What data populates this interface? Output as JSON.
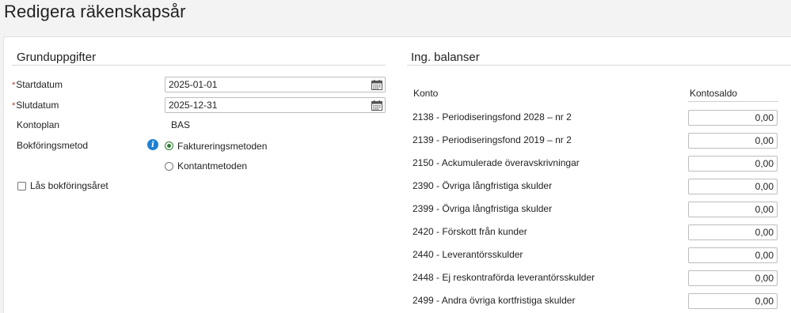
{
  "page": {
    "title": "Redigera räkenskapsår"
  },
  "grunduppgifter": {
    "title": "Grunduppgifter",
    "required_marker": "*",
    "startdatum_label": "Startdatum",
    "startdatum_value": "2025-01-01",
    "slutdatum_label": "Slutdatum",
    "slutdatum_value": "2025-12-31",
    "kontoplan_label": "Kontoplan",
    "kontoplan_value": "BAS",
    "bokforingsmetod_label": "Bokföringsmetod",
    "metod_options": [
      "Faktureringsmetoden",
      "Kontantmetoden"
    ],
    "metod_selected": "Faktureringsmetoden",
    "las_label": "Lås bokföringsåret",
    "las_checked": false
  },
  "balanser": {
    "title": "Ing. balanser",
    "col_konto": "Konto",
    "col_saldo": "Kontosaldo",
    "rows": [
      {
        "konto": "2138 - Periodiseringsfond 2028 – nr 2",
        "saldo": "0,00"
      },
      {
        "konto": "2139 - Periodiseringsfond 2019 – nr 2",
        "saldo": "0,00"
      },
      {
        "konto": "2150 - Ackumulerade överavskrivningar",
        "saldo": "0,00"
      },
      {
        "konto": "2390 - Övriga långfristiga skulder",
        "saldo": "0,00"
      },
      {
        "konto": "2399 - Övriga långfristiga skulder",
        "saldo": "0,00"
      },
      {
        "konto": "2420 - Förskott från kunder",
        "saldo": "0,00"
      },
      {
        "konto": "2440 - Leverantörsskulder",
        "saldo": "0,00"
      },
      {
        "konto": "2448 - Ej reskontraförda leverantörsskulder",
        "saldo": "0,00"
      },
      {
        "konto": "2499 - Andra övriga kortfristiga skulder",
        "saldo": "0,00"
      }
    ]
  }
}
